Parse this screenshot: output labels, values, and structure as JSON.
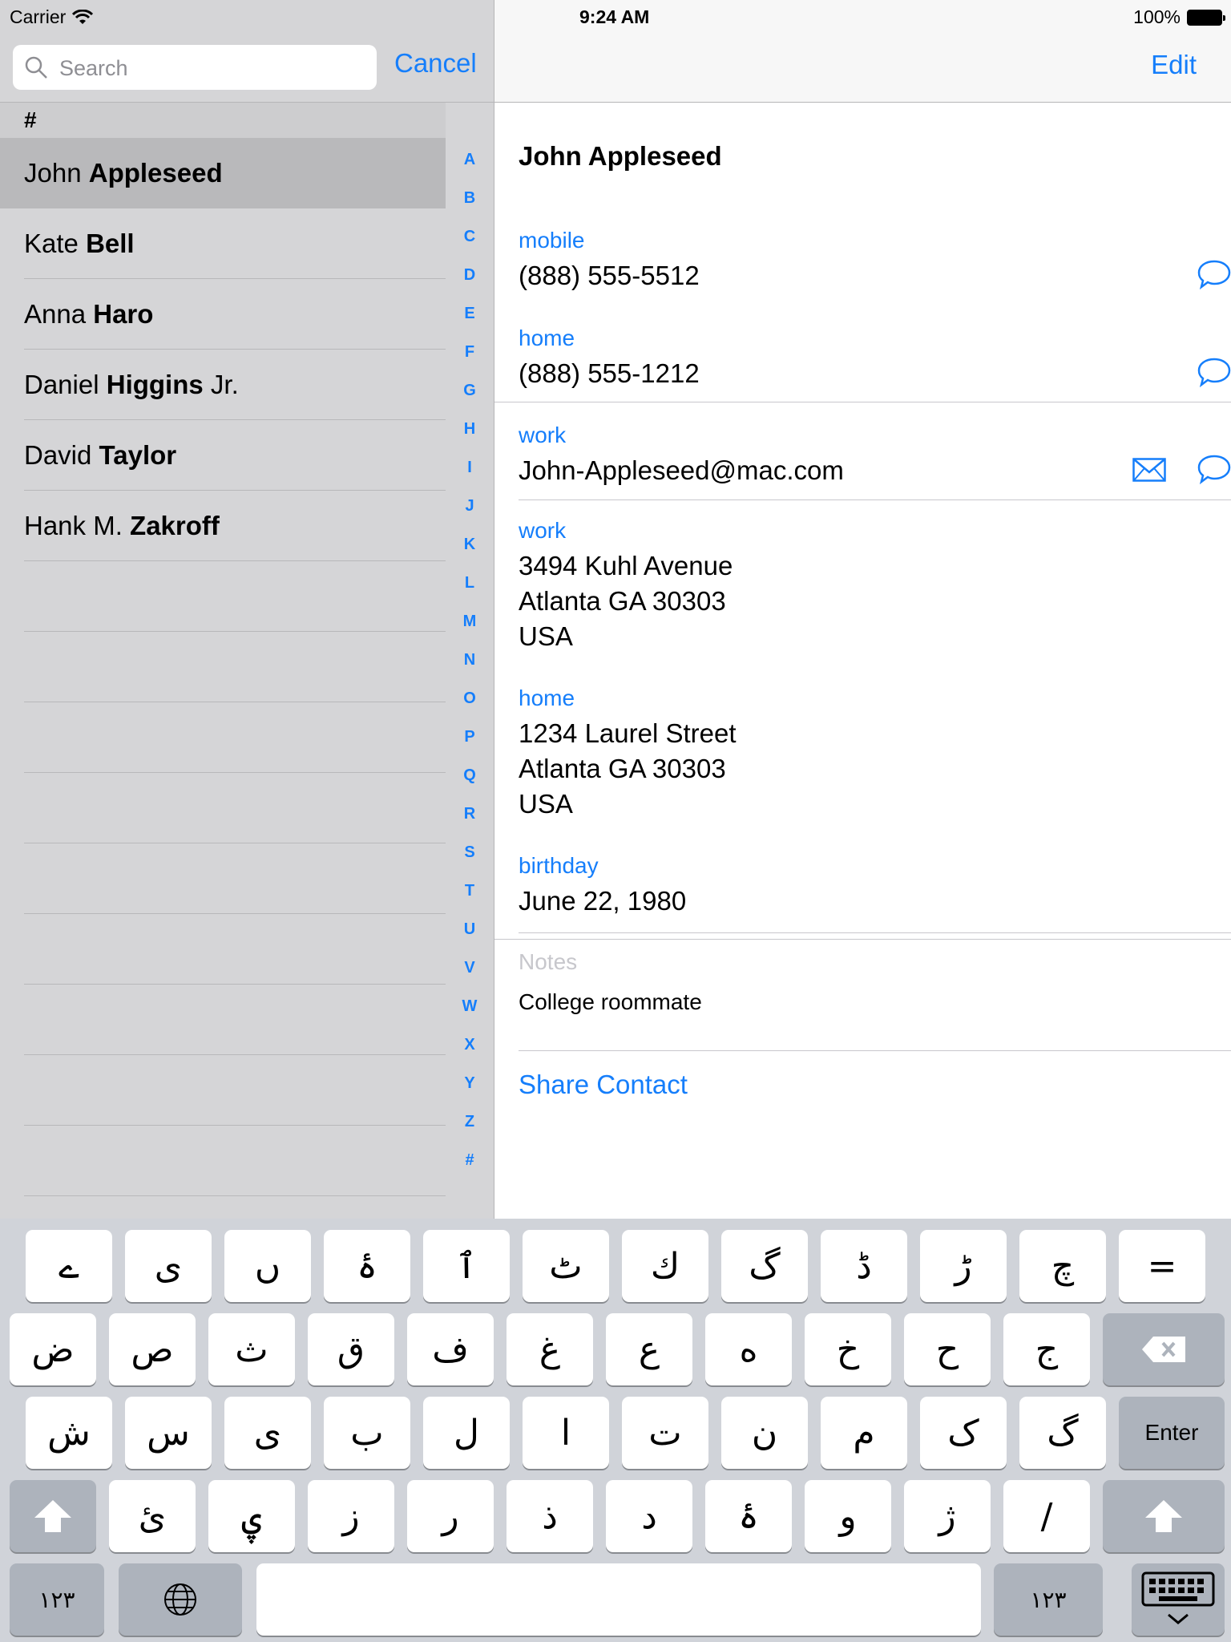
{
  "status_bar": {
    "carrier": "Carrier",
    "time": "9:24 AM",
    "battery": "100%"
  },
  "search": {
    "placeholder": "Search",
    "cancel_label": "Cancel"
  },
  "section_header": "#",
  "contacts": [
    {
      "first": "John",
      "last": "Appleseed",
      "suffix": "",
      "selected": true
    },
    {
      "first": "Kate",
      "last": "Bell",
      "suffix": ""
    },
    {
      "first": "Anna",
      "last": "Haro",
      "suffix": ""
    },
    {
      "first": "Daniel",
      "last": "Higgins",
      "suffix": "Jr."
    },
    {
      "first": "David",
      "last": "Taylor",
      "suffix": ""
    },
    {
      "first": "Hank M.",
      "last": "Zakroff",
      "suffix": ""
    }
  ],
  "index_letters": [
    "A",
    "B",
    "C",
    "D",
    "E",
    "F",
    "G",
    "H",
    "I",
    "J",
    "K",
    "L",
    "M",
    "N",
    "O",
    "P",
    "Q",
    "R",
    "S",
    "T",
    "U",
    "V",
    "W",
    "X",
    "Y",
    "Z",
    "#"
  ],
  "detail": {
    "edit_label": "Edit",
    "name": "John Appleseed",
    "mobile_label": "mobile",
    "mobile_value": "(888) 555-5512",
    "home_phone_label": "home",
    "home_phone_value": "(888) 555-1212",
    "email_label": "work",
    "email_value": "John-Appleseed@mac.com",
    "work_address_label": "work",
    "work_address_value": "3494 Kuhl Avenue\nAtlanta GA 30303\nUSA",
    "home_address_label": "home",
    "home_address_value": "1234 Laurel Street\nAtlanta GA 30303\nUSA",
    "birthday_label": "birthday",
    "birthday_value": "June 22, 1980",
    "notes_label": "Notes",
    "notes_value": "College roommate",
    "share_label": "Share Contact"
  },
  "keyboard": {
    "row1": [
      "ے",
      "ی",
      "ں",
      "ۂ",
      "ٱ",
      "ٹ",
      "ك",
      "گ",
      "ڈ",
      "ڑ",
      "چ",
      "="
    ],
    "row2": [
      "ض",
      "ص",
      "ث",
      "ق",
      "ف",
      "غ",
      "ع",
      "ه",
      "خ",
      "ح",
      "ج"
    ],
    "row3": [
      "ش",
      "س",
      "ی",
      "ب",
      "ل",
      "ا",
      "ت",
      "ن",
      "م",
      "ک",
      "گ"
    ],
    "row4": [
      "ئ",
      "ۑ",
      "ز",
      "ر",
      "ذ",
      "د",
      "ۂ",
      "و",
      "ژ",
      "/"
    ],
    "enter_label": "Enter",
    "numbers_label": "١٢٣"
  },
  "colors": {
    "accent": "#157efb",
    "left_panel_bg": "#d5d5d7",
    "keyboard_bg": "#d0d3d9"
  }
}
